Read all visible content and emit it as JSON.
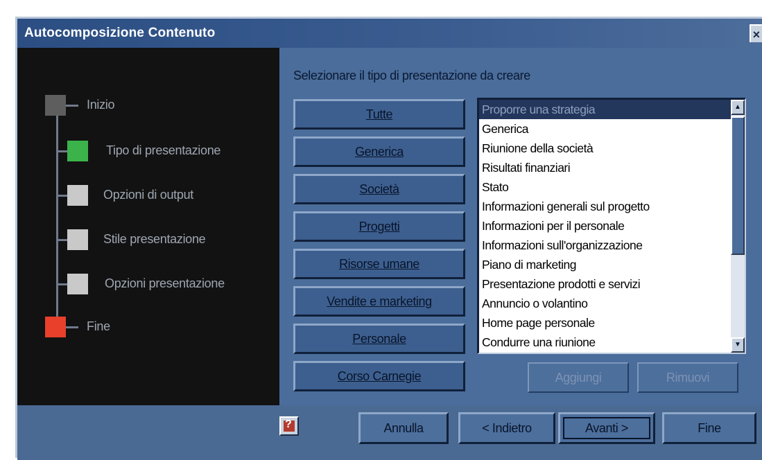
{
  "window": {
    "title": "Autocomposizione Contenuto",
    "close_label": "×"
  },
  "steps": [
    {
      "label": "Inizio",
      "color": "#5e5e5e"
    },
    {
      "label": "Tipo di presentazione",
      "color": "#3bb34a"
    },
    {
      "label": "Opzioni di output",
      "color": "#c9c9c9"
    },
    {
      "label": "Stile presentazione",
      "color": "#c9c9c9"
    },
    {
      "label": "Opzioni presentazione",
      "color": "#c9c9c9"
    },
    {
      "label": "Fine",
      "color": "#e8402a"
    }
  ],
  "main": {
    "prompt": "Selezionare il tipo di presentazione da creare",
    "categories": [
      "Tutte",
      "Generica",
      "Società",
      "Progetti",
      "Risorse umane",
      "Vendite e marketing",
      "Personale",
      "Corso Carnegie"
    ],
    "presentation_types": [
      "Proporre una strategia",
      "Generica",
      "Riunione della società",
      "Risultati finanziari",
      "Stato",
      "Informazioni generali sul progetto",
      "Informazioni per il personale",
      "Informazioni sull'organizzazione",
      "Piano di marketing",
      "Presentazione prodotti e servizi",
      "Annuncio o volantino",
      "Home page personale",
      "Condurre una riunione"
    ],
    "selected_index": 0,
    "add_label": "Aggiungi",
    "remove_label": "Rimuovi"
  },
  "footer": {
    "help_icon": "help-icon",
    "cancel_label": "Annulla",
    "back_label": "< Indietro",
    "next_label": "Avanti >",
    "finish_label": "Fine"
  },
  "colors": {
    "dialog_blue": "#4a6d9b",
    "titlebar": "#2b4e83",
    "wizard_bg": "#121212",
    "selection": "#23365c"
  }
}
